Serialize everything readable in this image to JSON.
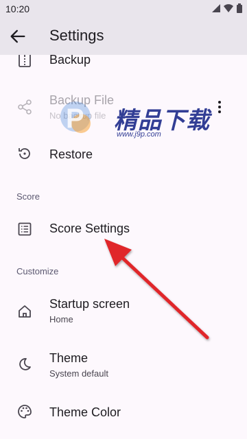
{
  "status_bar": {
    "time": "10:20"
  },
  "app_bar": {
    "title": "Settings"
  },
  "rows": {
    "backup": {
      "title": "Backup"
    },
    "backup_file": {
      "title": "Backup File",
      "summary": "No backup file"
    },
    "restore": {
      "title": "Restore"
    },
    "score_settings": {
      "title": "Score Settings"
    },
    "startup_screen": {
      "title": "Startup screen",
      "summary": "Home"
    },
    "theme": {
      "title": "Theme",
      "summary": "System default"
    },
    "theme_color": {
      "title": "Theme Color"
    }
  },
  "sections": {
    "score": "Score",
    "customize": "Customize"
  },
  "watermark": {
    "text": "精品下载",
    "url": "www.j9p.com"
  },
  "colors": {
    "app_bar": "#e9e5ec",
    "background": "#fdf8fd",
    "arrow": "#e0262b",
    "section_header": "#5b5870"
  },
  "icons": [
    "signal-icon",
    "wifi-icon",
    "battery-icon",
    "back-arrow-icon",
    "backup-icon",
    "share-icon",
    "more-vert-icon",
    "restore-icon",
    "list-icon",
    "home-icon",
    "dark-mode-icon",
    "palette-icon"
  ]
}
